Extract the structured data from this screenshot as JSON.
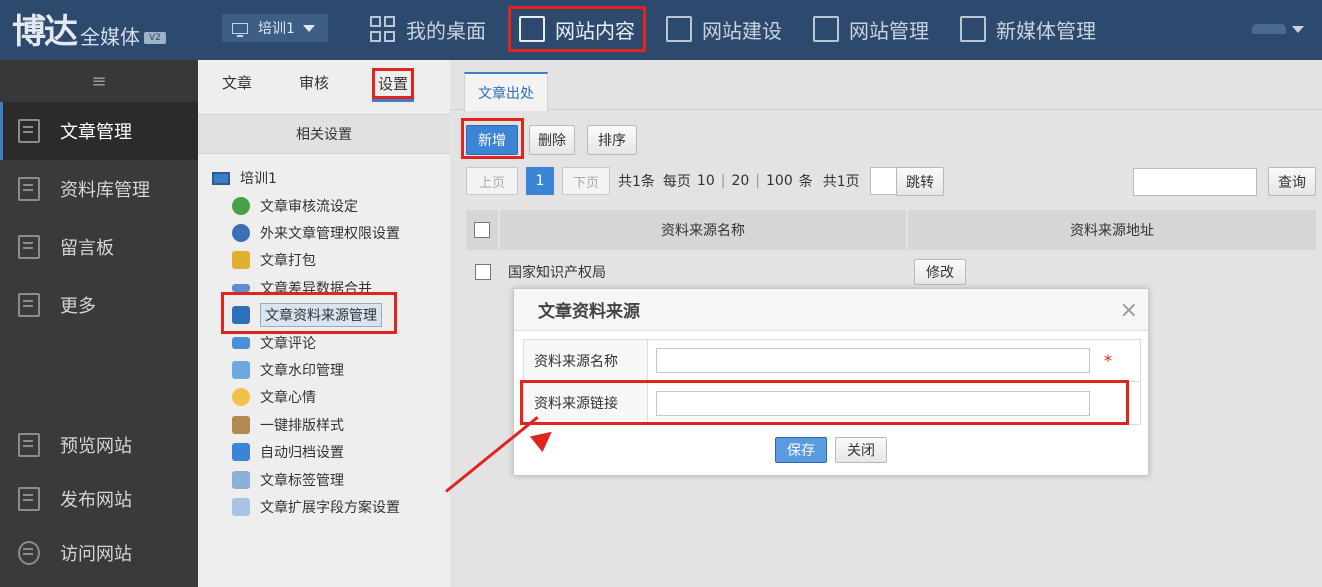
{
  "header": {
    "logo_main": "博达",
    "logo_sub": "全媒体",
    "logo_version": "V2",
    "site_select": "培训1",
    "nav": [
      {
        "label": "我的桌面"
      },
      {
        "label": "网站内容"
      },
      {
        "label": "网站建设"
      },
      {
        "label": "网站管理"
      },
      {
        "label": "新媒体管理"
      }
    ]
  },
  "sidebar": {
    "collapse_icon": "≡",
    "items": [
      {
        "label": "文章管理"
      },
      {
        "label": "资料库管理"
      },
      {
        "label": "留言板"
      },
      {
        "label": "更多"
      },
      {
        "label": "预览网站"
      },
      {
        "label": "发布网站"
      },
      {
        "label": "访问网站"
      }
    ]
  },
  "mid_panel": {
    "tabs": [
      "文章",
      "审核",
      "设置"
    ],
    "section_title": "相关设置",
    "tree_root": "培训1",
    "tree_items": [
      "文章审核流设定",
      "外来文章管理权限设置",
      "文章打包",
      "文章差异数据合并",
      "文章资料来源管理",
      "文章评论",
      "文章水印管理",
      "文章心情",
      "一键排版样式",
      "自动归档设置",
      "文章标签管理",
      "文章扩展字段方案设置"
    ]
  },
  "content": {
    "tab_label": "文章出处",
    "toolbar": {
      "add": "新增",
      "delete": "删除",
      "sort": "排序"
    },
    "pager": {
      "prev": "上页",
      "current": "1",
      "next": "下页",
      "total_items": "共1条",
      "per_page_label": "每页",
      "per_page_options": [
        "10",
        "20",
        "100"
      ],
      "per_page_unit": "条",
      "total_pages": "共1页",
      "jump": "跳转"
    },
    "search_button": "查询",
    "table": {
      "headers": [
        "资料来源名称",
        "资料来源地址"
      ],
      "rows": [
        {
          "name": "国家知识产权局",
          "action": "修改"
        }
      ]
    }
  },
  "dialog": {
    "title": "文章资料来源",
    "close_icon": "×",
    "fields": [
      {
        "label": "资料来源名称",
        "value": "",
        "required_mark": "*"
      },
      {
        "label": "资料来源链接",
        "value": ""
      }
    ],
    "save": "保存",
    "close": "关闭"
  },
  "colors": {
    "topbar": "#2d4a6e",
    "accent": "#3c84d6",
    "highlight": "#e0241e"
  }
}
